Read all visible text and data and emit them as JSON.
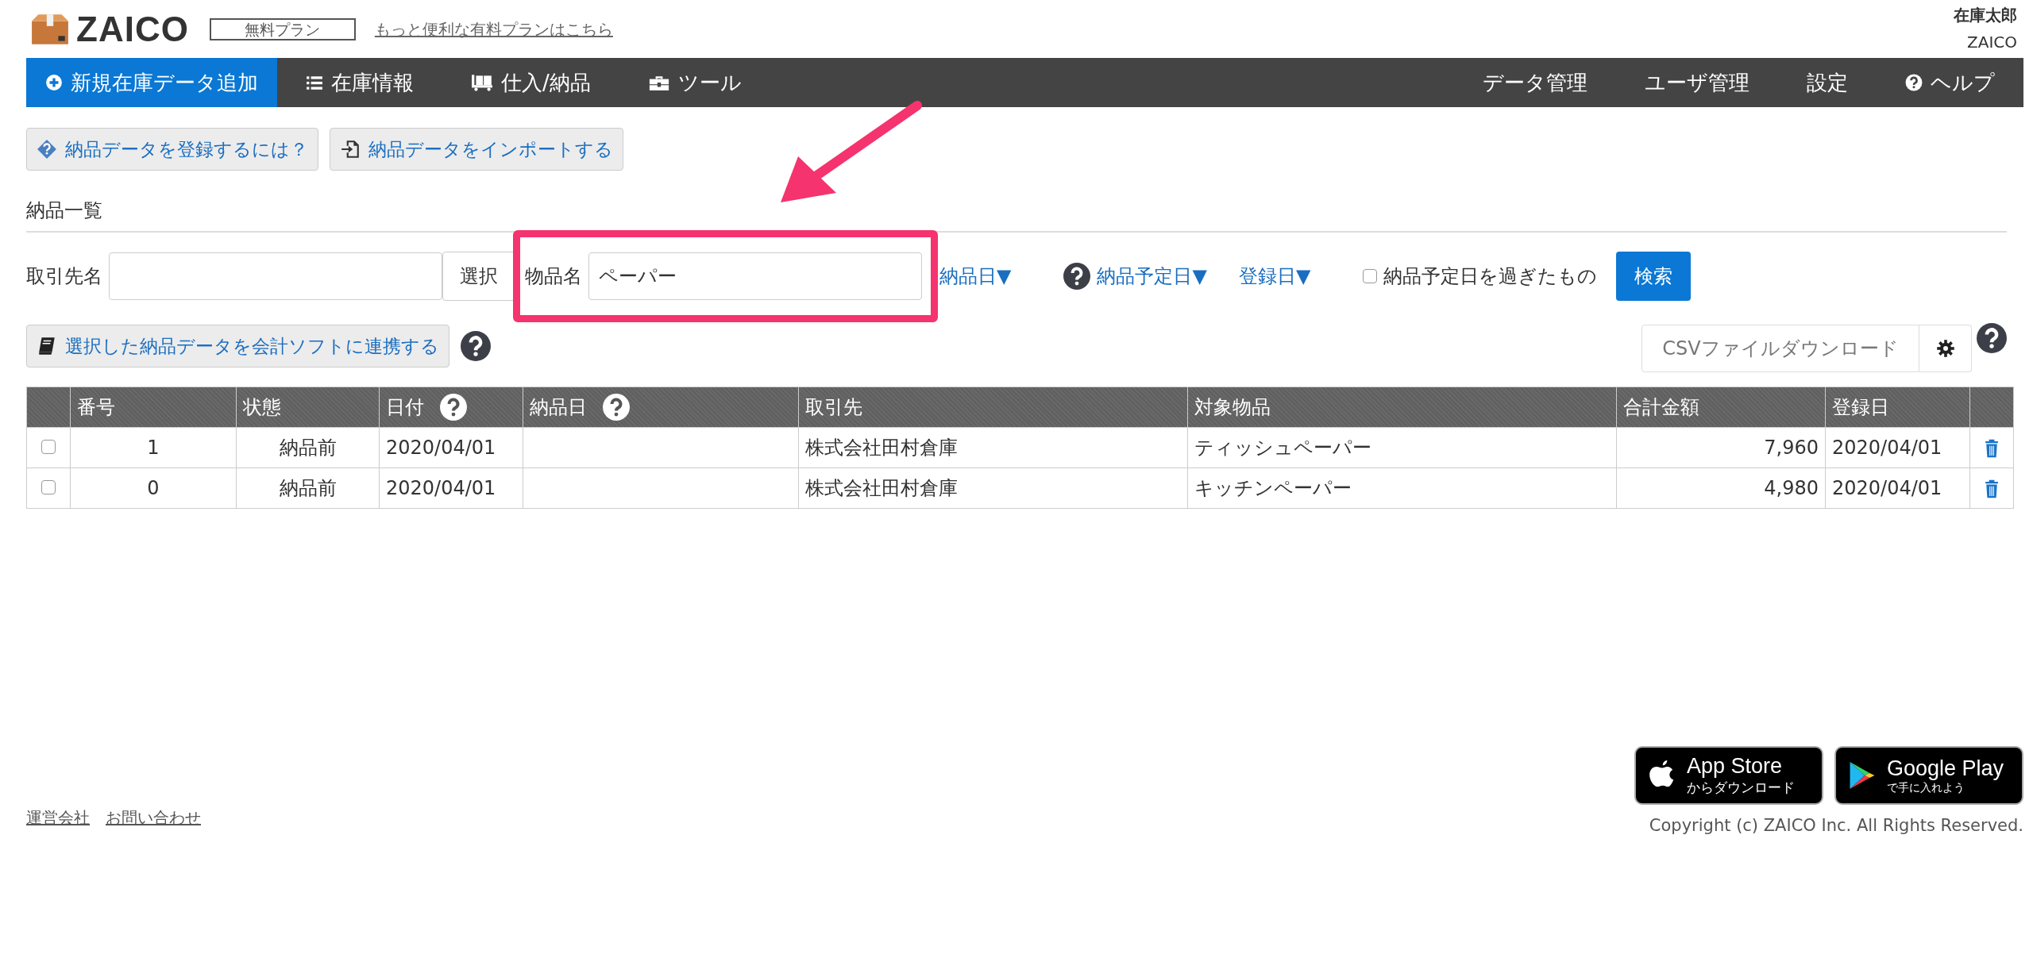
{
  "header": {
    "logo": "ZAICO",
    "plan_badge": "無料プラン",
    "upgrade_link": "もっと便利な有料プランはこちら",
    "user_name": "在庫太郎",
    "user_org": "ZAICO"
  },
  "nav": {
    "left": [
      {
        "label": "新規在庫データ追加",
        "selected": true
      },
      {
        "label": "在庫情報",
        "selected": false
      },
      {
        "label": "仕入/納品",
        "selected": false
      },
      {
        "label": "ツール",
        "selected": false
      }
    ],
    "right": [
      "データ管理",
      "ユーザ管理",
      "設定",
      "ヘルプ"
    ]
  },
  "actions": [
    "納品データを登録するには？",
    "納品データをインポートする"
  ],
  "section_title": "納品一覧",
  "filters": {
    "partner_label": "取引先名",
    "select_button": "選択",
    "item_label": "物品名",
    "item_value": "ペーパー",
    "sort_links": [
      {
        "label": "納品日▼",
        "help": false
      },
      {
        "label": "納品予定日▼",
        "help": true
      },
      {
        "label": "登録日▼",
        "help": false
      }
    ],
    "overdue": {
      "label": "納品予定日を過ぎたもの",
      "checked": false
    },
    "search_button": "検索"
  },
  "toolbar": {
    "link_button": "選択した納品データを会計ソフトに連携する",
    "csv_button": "CSVファイルダウンロード"
  },
  "table": {
    "columns": [
      {
        "label": "番号",
        "help": false
      },
      {
        "label": "状態",
        "help": false
      },
      {
        "label": "日付",
        "help": true
      },
      {
        "label": "納品日",
        "help": true
      },
      {
        "label": "取引先",
        "help": false
      },
      {
        "label": "対象物品",
        "help": false
      },
      {
        "label": "合計金額",
        "help": false
      },
      {
        "label": "登録日",
        "help": false
      }
    ],
    "rows": [
      {
        "checked": false,
        "cells": [
          "1",
          "納品前",
          "2020/04/01",
          "",
          "株式会社田村倉庫",
          "ティッシュペーパー",
          "7,960",
          "2020/04/01"
        ]
      },
      {
        "checked": false,
        "cells": [
          "0",
          "納品前",
          "2020/04/01",
          "",
          "株式会社田村倉庫",
          "キッチンペーパー",
          "4,980",
          "2020/04/01"
        ]
      }
    ]
  },
  "footer": {
    "links": [
      "運営会社",
      "お問い合わせ"
    ],
    "app_store": {
      "title": "App Store",
      "subtitle": "からダウンロード"
    },
    "google_play": {
      "title": "Google Play",
      "subtitle": "で手に入れよう"
    },
    "copyright": "Copyright (c) ZAICO Inc. All Rights Reserved."
  }
}
